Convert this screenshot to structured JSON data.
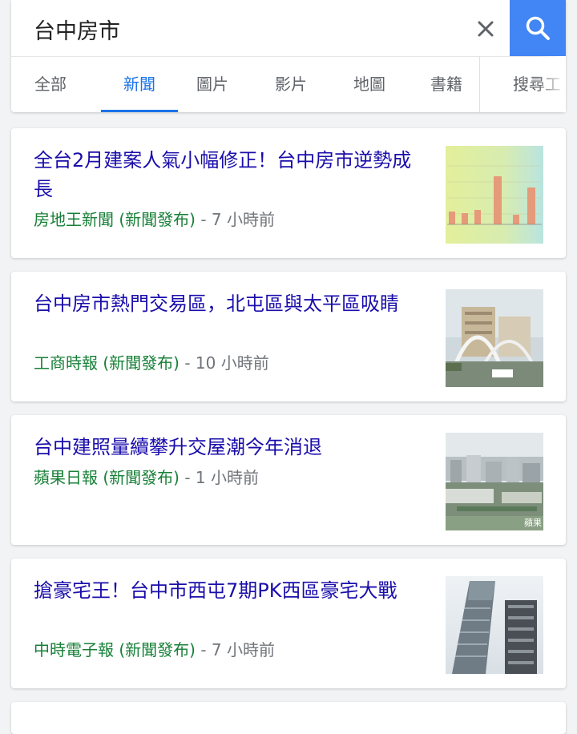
{
  "search": {
    "query": "台中房市"
  },
  "tabs": [
    "全部",
    "新聞",
    "圖片",
    "影片",
    "地圖",
    "書籍",
    "搜尋工"
  ],
  "results": [
    {
      "title": "全台2月建案人氣小幅修正！台中房市逆勢成長",
      "source": "房地王新聞 (新聞發布)",
      "time": " - 7 小時前",
      "thumb_icon": "bar-chart-thumbnail"
    },
    {
      "title": "台中房市熱門交易區，北屯區與太平區吸睛",
      "source": "工商時報 (新聞發布)",
      "time": " - 10 小時前",
      "thumb_icon": "bridge-city-thumbnail"
    },
    {
      "title": "台中建照量續攀升交屋潮今年消退",
      "source": "蘋果日報 (新聞發布)",
      "time": " - 1 小時前",
      "thumb_icon": "city-skyline-thumbnail",
      "thumb_watermark": "蘋果"
    },
    {
      "title": "搶豪宅王！台中市西屯7期PK西區豪宅大戰",
      "source": "中時電子報 (新聞發布)",
      "time": " - 7 小時前",
      "thumb_icon": "skyscraper-thumbnail"
    }
  ],
  "colors": {
    "accent": "#4285f4",
    "link": "#1a0dab",
    "source": "#188038",
    "meta": "#70757a"
  }
}
